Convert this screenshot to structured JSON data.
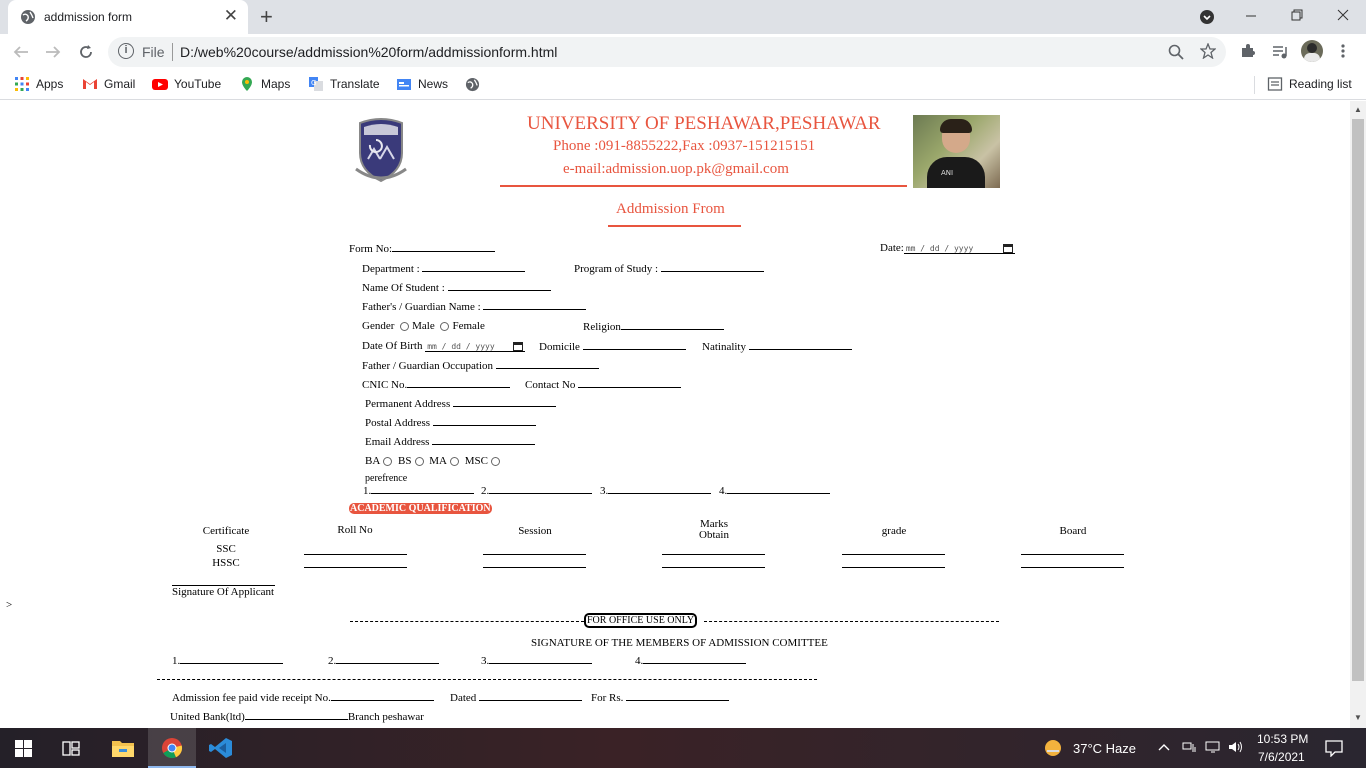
{
  "browser": {
    "tab_title": "addmission form",
    "tab_close": "✕",
    "new_tab": "+",
    "url_scheme": "File",
    "url": "D:/web%20course/addmission%20form/addmissionform.html",
    "bookmarks": [
      "Apps",
      "Gmail",
      "YouTube",
      "Maps",
      "Translate",
      "News"
    ],
    "reading_list": "Reading list"
  },
  "header": {
    "university": "UNIVERSITY OF PESHAWAR,PESHAWAR",
    "phone": "Phone :091-8855222,Fax :0937-151215151",
    "email": "e-mail:admission.uop.pk@gmail.com",
    "form_title": "Addmission From"
  },
  "form": {
    "form_no": "Form No:",
    "date": "Date:",
    "date_placeholder": "mm / dd / yyyy",
    "department": "Department :",
    "program": "Program of Study :",
    "student_name": "Name Of Student :",
    "guardian_name": "Father's / Guardian Name :",
    "gender": "Gender",
    "male": "Male",
    "female": "Female",
    "religion": "Religion",
    "dob": "Date Of Birth",
    "dob_placeholder": "mm / dd / yyyy",
    "domicile": "Domicile",
    "nationality": "Natinality",
    "guardian_occupation": "Father / Guardian Occupation",
    "cnic": "CNIC No.",
    "contact": "Contact No",
    "permanent_address": "Permanent Address",
    "postal_address": "Postal Address",
    "email_address": "Email Address",
    "programs": [
      "BA",
      "BS",
      "MA",
      "MSC"
    ],
    "preference": "perefrence",
    "preference_numbers": [
      "1.",
      "2.",
      "3.",
      "4."
    ],
    "stray_char": ">"
  },
  "academic": {
    "heading": "ACADEMIC QUALIFICATION",
    "columns": [
      "Certificate",
      "Roll No",
      "Session",
      "Marks Obtain",
      "grade",
      "Board"
    ],
    "rows": [
      "SSC",
      "HSSC"
    ],
    "signature": "Signature Of Applicant"
  },
  "office": {
    "heading": "FOR OFFICE USE ONLY",
    "committee": "SIGNATURE OF THE MEMBERS OF ADMISSION COMITTEE",
    "members": [
      "1.",
      "2.",
      "3.",
      "4."
    ],
    "fee": "Admission fee paid vide receipt No.",
    "dated": "Dated",
    "for_rs": "For Rs.",
    "bank": "United Bank(ltd)",
    "branch": "Branch peshawar"
  },
  "taskbar": {
    "weather": "37°C  Haze",
    "time": "10:53 PM",
    "date": "7/6/2021"
  },
  "colors": {
    "accent_red": "#e8553f",
    "chrome_bg": "#dee1e6"
  }
}
